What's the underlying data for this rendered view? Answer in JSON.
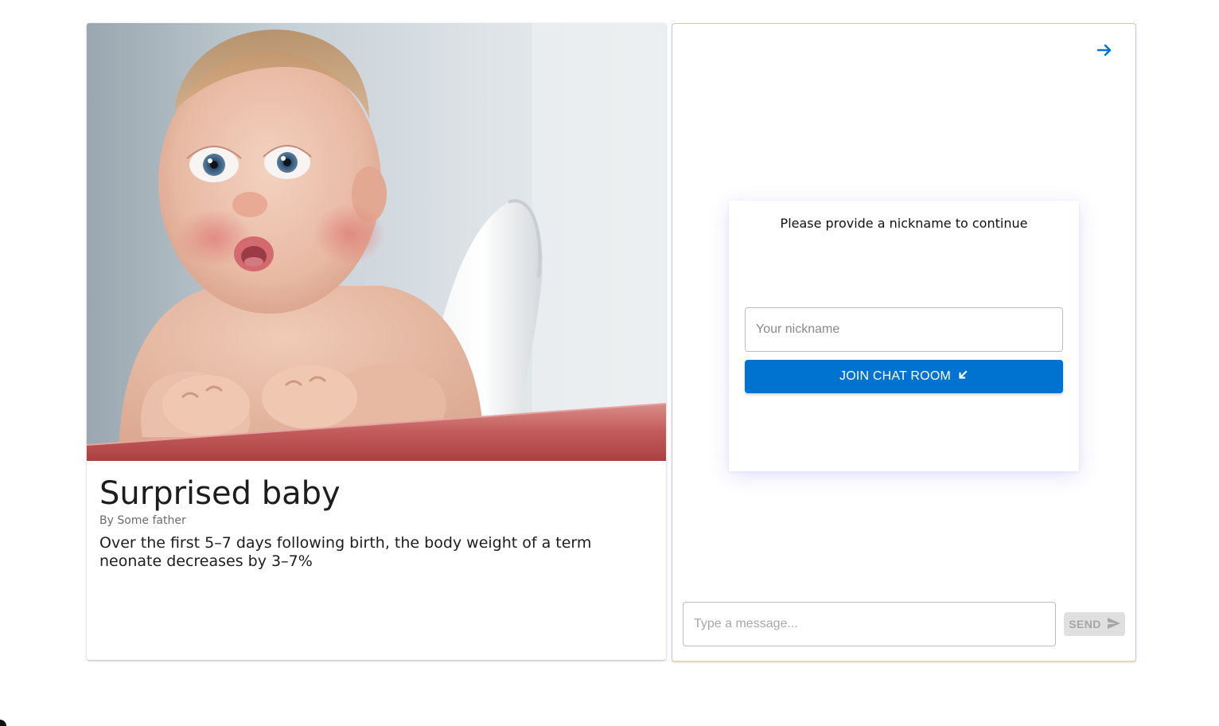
{
  "article": {
    "image_alt": "surprised baby photo",
    "title": "Surprised baby",
    "byline": "By Some father",
    "text": "Over the first 5–7 days following birth, the body weight of a term neonate decreases by 3–7%"
  },
  "chat": {
    "forward_icon": "arrow-right-icon",
    "nickname_prompt": "Please provide a nickname to continue",
    "nickname_placeholder": "Your nickname",
    "join_label": "JOIN CHAT ROOM",
    "join_icon": "arrow-down-left-icon",
    "message_placeholder": "Type a message...",
    "send_label": "SEND",
    "send_icon": "send-icon"
  },
  "colors": {
    "accent": "#0072cf",
    "send_disabled_bg": "#e0e0e0",
    "send_disabled_text": "#a6a6a6"
  }
}
